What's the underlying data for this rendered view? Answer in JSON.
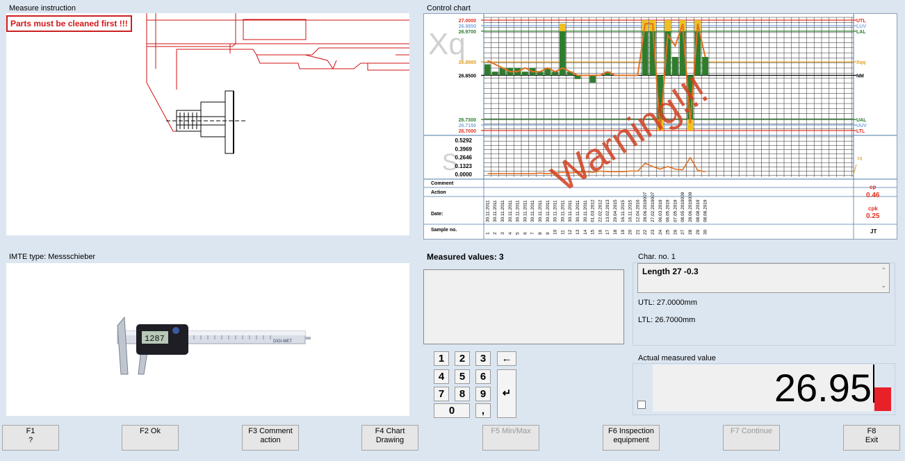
{
  "measure_instruction": {
    "title": "Measure instruction",
    "warning": "Parts must be cleaned first !!!"
  },
  "control_chart": {
    "title": "Control chart",
    "watermark_x": "Xq",
    "watermark_s": "S",
    "warning_overlay": "Warning!!!",
    "comment_label": "Comment",
    "action_label": "Action",
    "date_label": "Date:",
    "sample_label": "Sample no.",
    "cp_label": "cp",
    "cp_value": "0.46",
    "cpk_label": "cpk",
    "cpk_value": "0.25",
    "jt_label": "JT",
    "sq_label": "sq",
    "colors": {
      "utl": "#e03020",
      "luv": "#80a8d8",
      "lal": "#2a7a2a",
      "xqq": "#e0a020",
      "nm": "#000000",
      "bar": "#2e7d2e",
      "bar_out": "#f0c020",
      "line": "#e07020"
    }
  },
  "chart_data": {
    "type": "bar",
    "xbar_axis_labels": [
      {
        "value": 27.0,
        "text": "27.0000",
        "tag": "UTL",
        "color": "#e03020"
      },
      {
        "value": 26.985,
        "text": "26.9850",
        "tag": "LUV",
        "color": "#80a8d8"
      },
      {
        "value": 26.97,
        "text": "26.9700",
        "tag": "LAL",
        "color": "#2a7a2a"
      },
      {
        "value": 26.8865,
        "text": "26.8865",
        "tag": "Xqq",
        "color": "#e0a020"
      },
      {
        "value": 26.85,
        "text": "26.8500",
        "tag": "NM",
        "color": "#000000"
      },
      {
        "value": 26.73,
        "text": "26.7300",
        "tag": "UAL",
        "color": "#2a7a2a"
      },
      {
        "value": 26.715,
        "text": "26.7150",
        "tag": "UUV",
        "color": "#80a8d8"
      },
      {
        "value": 26.7,
        "text": "26.7000",
        "tag": "LTL",
        "color": "#e03020"
      }
    ],
    "ylim": [
      26.7,
      27.0
    ],
    "s_axis_ticks": [
      "0.5292",
      "0.3969",
      "0.2646",
      "0.1323",
      "0.0000"
    ],
    "s_ylim": [
      0,
      0.5292
    ],
    "samples": [
      "1",
      "2",
      "3",
      "4",
      "5",
      "6",
      "7",
      "8",
      "9",
      "10",
      "11",
      "12",
      "13",
      "14",
      "15",
      "16",
      "17",
      "18",
      "19",
      "20",
      "21",
      "22",
      "23",
      "24",
      "25",
      "26",
      "27",
      "28",
      "29",
      "30"
    ],
    "dates": [
      "30.11.2011",
      "30.11.2011",
      "30.11.2011",
      "30.11.2011",
      "30.11.2011",
      "30.11.2011",
      "30.11.2011",
      "30.11.2011",
      "30.11.2011",
      "30.11.2011",
      "30.11.2011",
      "30.11.2011",
      "30.11.2011",
      "30.11.2011",
      "01.03.2012",
      "22.02.2012",
      "13.02.2013",
      "29.04.2015",
      "16.11.2015",
      "16.11.2015",
      "12.04.2016",
      "28.06.2019007",
      "27.02.2019007",
      "06.03.2019",
      "06.05.2019",
      "07.05.2019",
      "08.05.2019009",
      "28.06.2019009",
      "08.08.2019",
      "08.08.2019"
    ],
    "xbar_values": [
      26.88,
      26.86,
      26.87,
      26.87,
      26.87,
      26.86,
      26.87,
      26.86,
      26.87,
      26.86,
      26.99,
      26.86,
      26.84,
      26.85,
      26.83,
      26.85,
      26.86,
      26.85,
      26.85,
      26.85,
      26.85,
      27.0,
      27.0,
      26.7,
      27.0,
      26.9,
      27.0,
      26.7,
      27.0,
      26.9
    ],
    "xq_values": [
      26.89,
      26.88,
      26.87,
      26.86,
      26.86,
      26.87,
      26.86,
      26.86,
      26.87,
      26.86,
      26.87,
      26.86,
      26.85,
      26.85,
      26.85,
      26.85,
      26.86,
      26.85,
      26.85,
      26.85,
      26.85,
      26.99,
      26.99,
      26.7,
      26.96,
      26.93,
      26.99,
      26.72,
      26.99,
      26.9
    ],
    "s_values": [
      0.01,
      0.01,
      0.01,
      0.01,
      0.01,
      0.01,
      0.01,
      0.02,
      0.01,
      0.02,
      0.03,
      0.02,
      0.03,
      0.04,
      0.03,
      0.05,
      0.04,
      0.04,
      0.04,
      0.05,
      0.05,
      0.17,
      0.12,
      0.08,
      0.12,
      0.08,
      0.07,
      0.26,
      0.06,
      0.04
    ]
  },
  "imte": {
    "title": "IMTE type: Messschieber",
    "display_value": "1287",
    "brand": "DIGI-MET"
  },
  "measured": {
    "label": "Measured values: 3"
  },
  "keypad": {
    "keys": [
      "1",
      "2",
      "3",
      "←",
      "4",
      "5",
      "6",
      "7",
      "8",
      "9",
      "↵",
      "0",
      ","
    ]
  },
  "characteristic": {
    "title": "Char. no. 1",
    "name": "Length 27 -0.3",
    "utl": "UTL: 27.0000mm",
    "ltl": "LTL: 26.7000mm"
  },
  "actual": {
    "title": "Actual measured value",
    "value": "26.95"
  },
  "function_keys": [
    {
      "line1": "F1",
      "line2": "?"
    },
    {
      "line1": "F2 Ok",
      "line2": ""
    },
    {
      "line1": "F3 Comment",
      "line2": "action"
    },
    {
      "line1": "F4 Chart",
      "line2": "Drawing"
    },
    {
      "line1": "F5 Min/Max",
      "line2": ""
    },
    {
      "line1": "F6 Inspection",
      "line2": "equipment"
    },
    {
      "line1": "F7 Continue",
      "line2": ""
    },
    {
      "line1": "F8",
      "line2": "Exit"
    }
  ]
}
